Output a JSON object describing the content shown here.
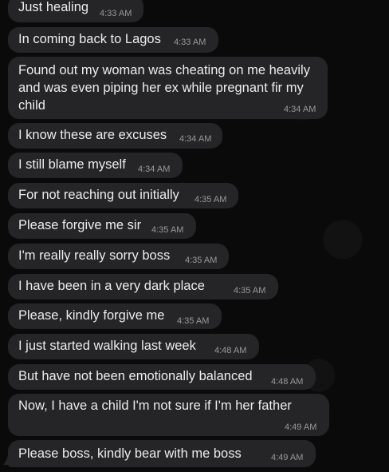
{
  "messages": [
    {
      "text": "Just healing",
      "time": "4:33 AM"
    },
    {
      "text": "In coming back to Lagos",
      "time": "4:33 AM"
    },
    {
      "text": "Found out my woman was cheating on me heavily and was even piping her ex while pregnant fir my child",
      "time": "4:34 AM"
    },
    {
      "text": "I know these are excuses",
      "time": "4:34 AM"
    },
    {
      "text": "I still blame myself",
      "time": "4:34 AM"
    },
    {
      "text": "For not reaching out initially",
      "time": "4:35 AM"
    },
    {
      "text": "Please forgive me sir",
      "time": "4:35 AM"
    },
    {
      "text": "I'm really really sorry boss",
      "time": "4:35 AM"
    },
    {
      "text": "I have been in a very dark place",
      "time": "4:35 AM"
    },
    {
      "text": "Please, kindly forgive me",
      "time": "4:35 AM"
    },
    {
      "text": "I just started walking last week",
      "time": "4:48 AM"
    },
    {
      "text": "But have not been emotionally balanced",
      "time": "4:48 AM"
    },
    {
      "text": "Now, I have a child I'm not sure if I'm her father",
      "time": "4:49 AM"
    },
    {
      "text": "Please boss, kindly bear with me boss",
      "time": "4:49 AM"
    }
  ]
}
